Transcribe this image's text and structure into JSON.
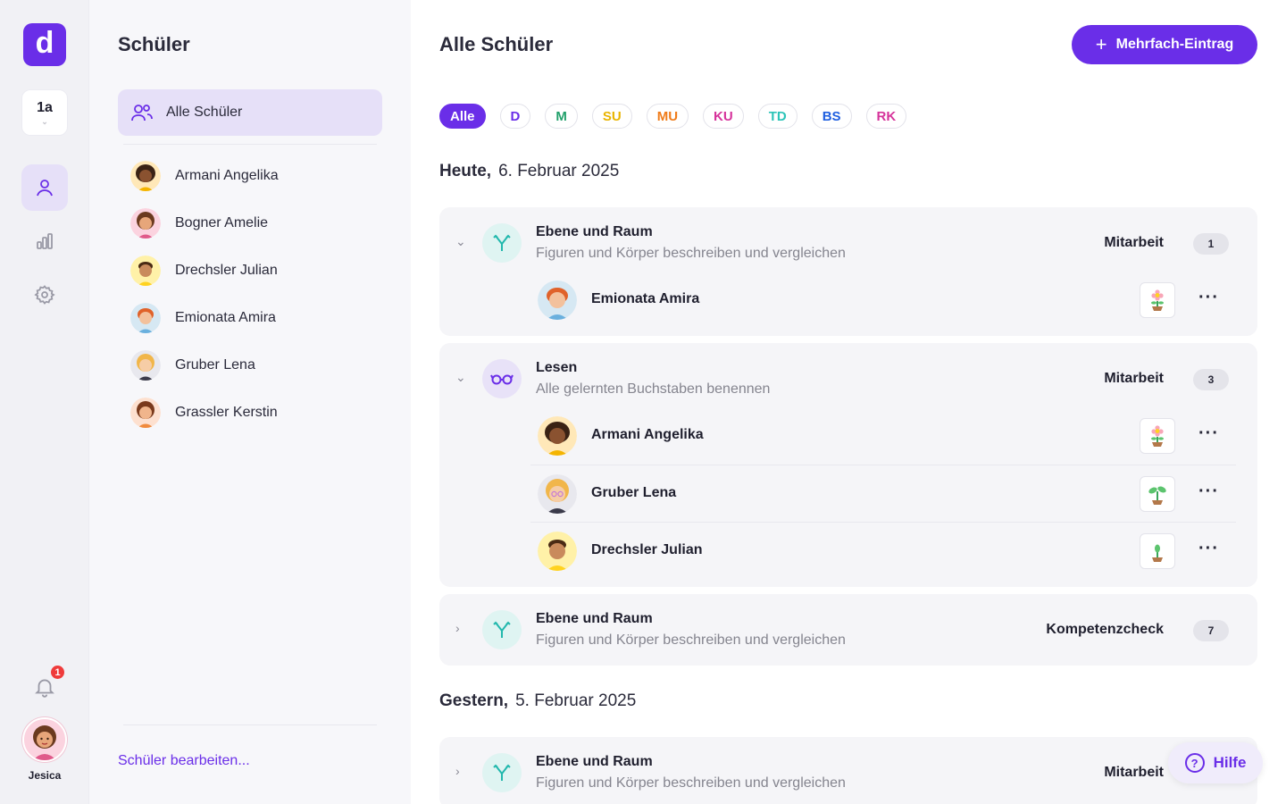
{
  "rail": {
    "logo_letter": "d",
    "class_label": "1a",
    "notifications_count": "1",
    "user_name": "Jesica"
  },
  "list": {
    "title": "Schüler",
    "all_label": "Alle Schüler",
    "students": [
      {
        "name": "Armani Angelika"
      },
      {
        "name": "Bogner Amelie"
      },
      {
        "name": "Drechsler Julian"
      },
      {
        "name": "Emionata Amira"
      },
      {
        "name": "Gruber Lena"
      },
      {
        "name": "Grassler Kerstin"
      }
    ],
    "edit_link": "Schüler bearbeiten..."
  },
  "main": {
    "title": "Alle Schüler",
    "primary_button": "Mehrfach-Eintrag",
    "filters": [
      {
        "label": "Alle",
        "color": "#ffffff"
      },
      {
        "label": "D",
        "color": "#6a2ee8"
      },
      {
        "label": "M",
        "color": "#22a06b"
      },
      {
        "label": "SU",
        "color": "#e9b400"
      },
      {
        "label": "MU",
        "color": "#f07c1a"
      },
      {
        "label": "KU",
        "color": "#d6339b"
      },
      {
        "label": "TD",
        "color": "#2cc4b8"
      },
      {
        "label": "BS",
        "color": "#1f5fe0"
      },
      {
        "label": "RK",
        "color": "#d6339b"
      }
    ],
    "today": {
      "label": "Heute,",
      "date": "6. Februar 2025"
    },
    "yesterday": {
      "label": "Gestern,",
      "date": "5. Februar 2025"
    },
    "cards": [
      {
        "title": "Ebene und Raum",
        "subtitle": "Figuren und Körper beschreiben und vergleichen",
        "type": "Mitarbeit",
        "count": "1",
        "entries": [
          {
            "name": "Emionata Amira"
          }
        ]
      },
      {
        "title": "Lesen",
        "subtitle": "Alle gelernten Buchstaben benennen",
        "type": "Mitarbeit",
        "count": "3",
        "entries": [
          {
            "name": "Armani Angelika"
          },
          {
            "name": "Gruber Lena"
          },
          {
            "name": "Drechsler Julian"
          }
        ]
      },
      {
        "title": "Ebene und Raum",
        "subtitle": "Figuren und Körper beschreiben und vergleichen",
        "type": "Kompetenzcheck",
        "count": "7",
        "entries": []
      },
      {
        "title": "Ebene und Raum",
        "subtitle": "Figuren und Körper beschreiben und vergleichen",
        "type": "Mitarbeit",
        "count": "",
        "entries": []
      }
    ],
    "help_label": "Hilfe"
  }
}
